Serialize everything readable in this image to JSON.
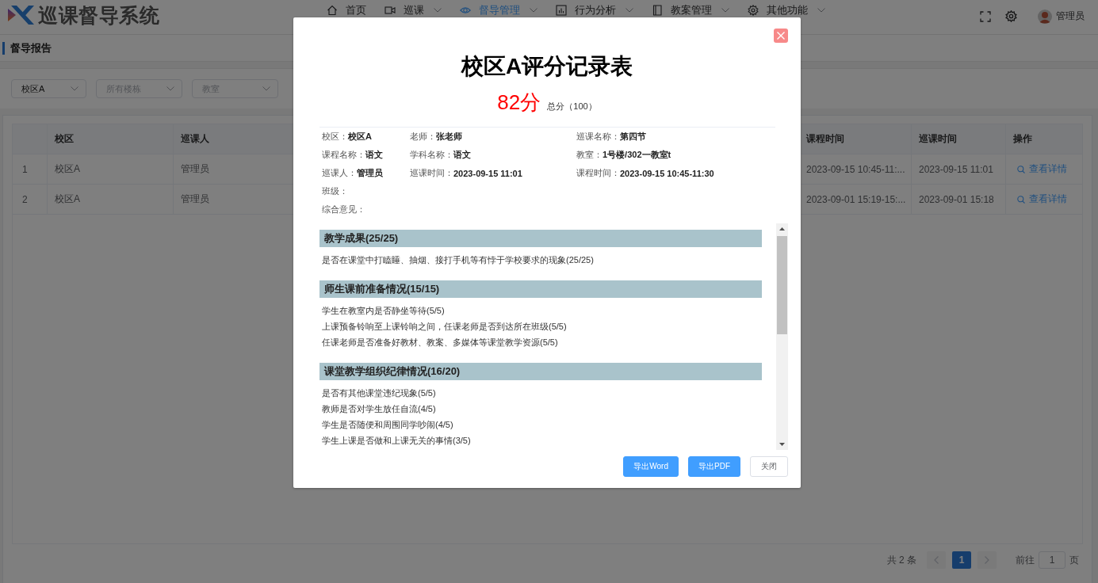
{
  "header": {
    "title": "巡课督导系统",
    "nav": [
      {
        "label": "首页",
        "has_menu": false,
        "selected": false
      },
      {
        "label": "巡课",
        "has_menu": true,
        "selected": false
      },
      {
        "label": "督导管理",
        "has_menu": true,
        "selected": true
      },
      {
        "label": "行为分析",
        "has_menu": true,
        "selected": false
      },
      {
        "label": "教案管理",
        "has_menu": true,
        "selected": false
      },
      {
        "label": "其他功能",
        "has_menu": true,
        "selected": false
      }
    ],
    "user": "管理员"
  },
  "breadcrumb": "督导报告",
  "filters": [
    {
      "value": "校区A"
    },
    {
      "placeholder": "所有楼栋"
    },
    {
      "placeholder": "教室"
    }
  ],
  "table": {
    "columns": [
      "校区",
      "巡课人",
      "课程时间",
      "巡课时间",
      "操作"
    ],
    "rows": [
      {
        "number": "1",
        "cells": [
          "校区A",
          "管理员",
          "2023-09-15 10:45-11:...",
          "2023-09-15 11:01"
        ],
        "action": "查看详情"
      },
      {
        "number": "2",
        "cells": [
          "校区A",
          "管理员",
          "2023-09-01 15:19-15:...",
          "2023-09-01 15:18"
        ],
        "action": "查看详情"
      }
    ]
  },
  "pagination": {
    "total": "共 2 条",
    "prev_disabled": true,
    "next_disabled": true,
    "pages": [
      {
        "label": "1",
        "selected": true
      }
    ],
    "goto": "前往",
    "goto_value": "1",
    "unit": "页"
  },
  "dialog": {
    "title": "校区A评分记录表",
    "score": "82分",
    "total": "总分（100）",
    "info": [
      [
        {
          "label": "校区：",
          "value": "校区A"
        },
        {
          "label": "老师：",
          "value": "张老师"
        },
        {
          "label": "巡课名称：",
          "value": "第四节"
        }
      ],
      [
        {
          "label": "课程名称：",
          "value": "语文"
        },
        {
          "label": "学科名称：",
          "value": "语文"
        },
        {
          "label": "教室：",
          "value": "1号楼/302一教室t"
        }
      ],
      [
        {
          "label": "巡课人：",
          "value": "管理员"
        },
        {
          "label": "巡课时间：",
          "value": "2023-09-15 11:01"
        },
        {
          "label": "课程时间：",
          "value": "2023-09-15 10:45-11:30"
        }
      ],
      [
        {
          "label": "班级："
        }
      ],
      [
        {
          "label": "综合意见："
        }
      ]
    ],
    "sections": [
      {
        "title": "教学成果(25/25)",
        "items": [
          "是否在课堂中打瞌睡、抽烟、接打手机等有悖于学校要求的现象(25/25)"
        ]
      },
      {
        "title": "师生课前准备情况(15/15)",
        "items": [
          "学生在教室内是否静坐等待(5/5)",
          "上课预备铃响至上课铃响之间，任课老师是否到达所在班级(5/5)",
          "任课老师是否准备好教材、教案、多媒体等课堂教学资源(5/5)"
        ]
      },
      {
        "title": "课堂教学组织纪律情况(16/20)",
        "items": [
          "是否有其他课堂违纪现象(5/5)",
          "教师是否对学生放任自流(4/5)",
          "学生是否随便和周围同学吵闹(4/5)",
          "学生上课是否做和上课无关的事情(3/5)"
        ]
      }
    ],
    "buttons": [
      {
        "label": "导出Word",
        "kind": "primary"
      },
      {
        "label": "导出PDF",
        "kind": "primary"
      },
      {
        "label": "关闭",
        "kind": "default"
      }
    ]
  }
}
